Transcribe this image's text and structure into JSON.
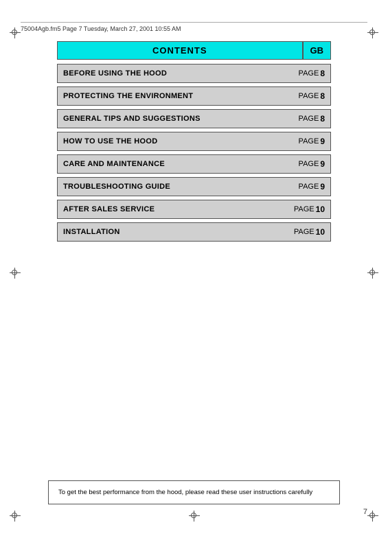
{
  "header": {
    "file_info": "75004Agb.fm5  Page 7  Tuesday, March 27, 2001  10:55 AM"
  },
  "contents": {
    "title": "CONTENTS",
    "gb_label": "GB",
    "items": [
      {
        "label": "BEFORE USING THE HOOD",
        "page_text": "PAGE",
        "page_num": "8"
      },
      {
        "label": "PROTECTING THE ENVIRONMENT",
        "page_text": "PAGE",
        "page_num": "8"
      },
      {
        "label": "GENERAL TIPS AND SUGGESTIONS",
        "page_text": "PAGE",
        "page_num": "8"
      },
      {
        "label": "HOW TO USE THE HOOD",
        "page_text": "PAGE",
        "page_num": "9"
      },
      {
        "label": "CARE AND MAINTENANCE",
        "page_text": "PAGE",
        "page_num": "9"
      },
      {
        "label": "TROUBLESHOOTING GUIDE",
        "page_text": "PAGE",
        "page_num": "9"
      },
      {
        "label": "AFTER SALES SERVICE",
        "page_text": "PAGE",
        "page_num": "10"
      },
      {
        "label": "INSTALLATION",
        "page_text": "PAGE",
        "page_num": "10"
      }
    ]
  },
  "bottom_note": "To get the best performance from the hood, please read these user instructions carefully",
  "page_number": "7"
}
